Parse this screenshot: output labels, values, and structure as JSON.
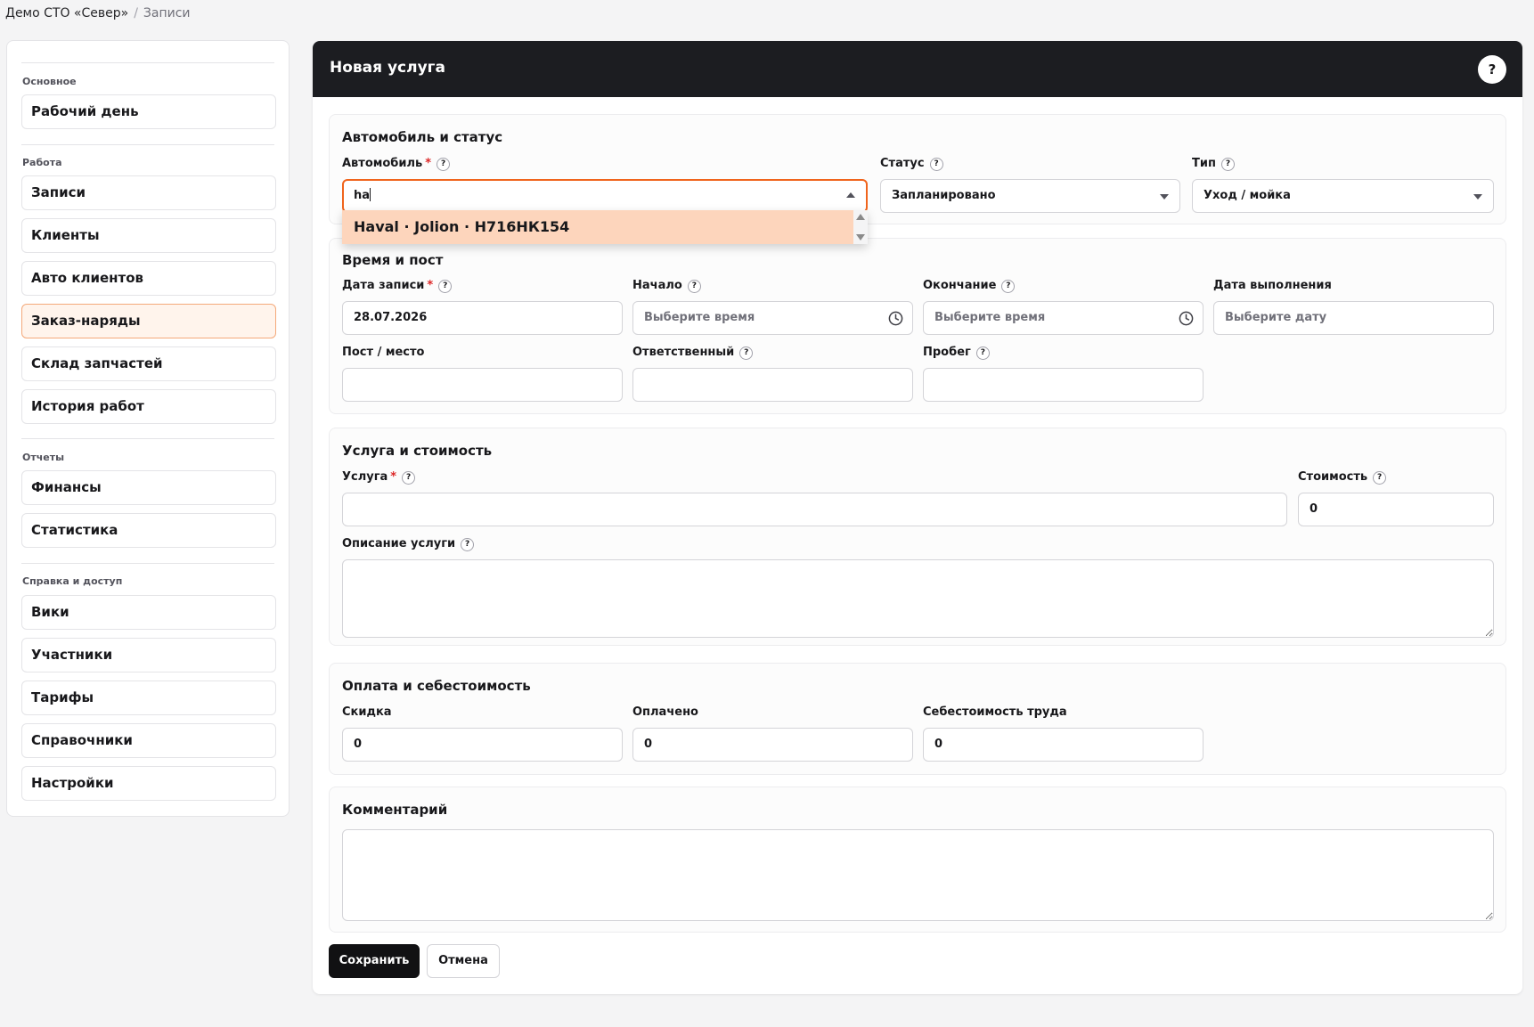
{
  "breadcrumb": {
    "org": "Демо СТО «Север»",
    "separator": "/",
    "current": "Записи"
  },
  "sidebar": {
    "groups": [
      "Основное",
      "Работа",
      "Отчеты",
      "Справка и доступ"
    ],
    "items": [
      "Рабочий день",
      "Записи",
      "Клиенты",
      "Авто клиентов",
      "Заказ-наряды",
      "Склад запчастей",
      "История работ",
      "Финансы",
      "Статистика",
      "Вики",
      "Участники",
      "Тарифы",
      "Справочники",
      "Настройки"
    ],
    "active_item": "Заказ-наряды"
  },
  "panel": {
    "title": "Новая услуга",
    "help": "?"
  },
  "help_glyph": "?",
  "required_mark": "*",
  "car_status": {
    "title": "Автомобиль и статус",
    "car_label": "Автомобиль",
    "car_value": "ha",
    "car_option": "Haval · Jolion · Н716НК154",
    "status_label": "Статус",
    "status_value": "Запланировано",
    "type_label": "Тип",
    "type_value": "Уход / мойка"
  },
  "time_post": {
    "title": "Время и пост",
    "date_label": "Дата записи",
    "date_value": "28.07.2026",
    "start_label": "Начало",
    "start_placeholder": "Выберите время",
    "end_label": "Окончание",
    "end_placeholder": "Выберите время",
    "done_label": "Дата выполнения",
    "done_placeholder": "Выберите дату",
    "post_label": "Пост / место",
    "responsible_label": "Ответственный",
    "mileage_label": "Пробег"
  },
  "service": {
    "title": "Услуга и стоимость",
    "service_label": "Услуга",
    "cost_label": "Стоимость",
    "cost_value": "0",
    "desc_label": "Описание услуги"
  },
  "payment": {
    "title": "Оплата и себестоимость",
    "discount_label": "Скидка",
    "discount_value": "0",
    "paid_label": "Оплачено",
    "paid_value": "0",
    "labor_label": "Себестоимость труда",
    "labor_value": "0"
  },
  "comment": {
    "title": "Комментарий"
  },
  "actions": {
    "save": "Сохранить",
    "cancel": "Отмена"
  },
  "colors": {
    "accent": "#f0641c",
    "dropdown_highlight": "#fdd5bc",
    "header": "#1c1d21",
    "active_item_bg": "#fff4ec"
  }
}
